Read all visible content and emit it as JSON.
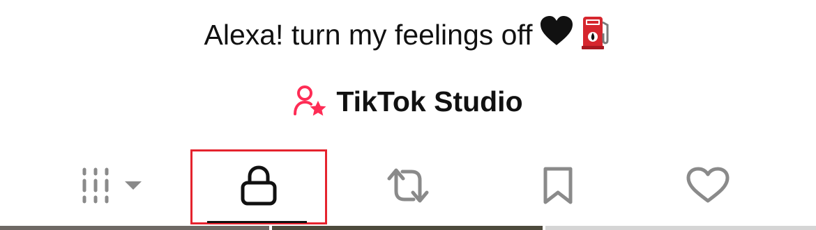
{
  "profile": {
    "bio": "Alexa! turn my feelings off",
    "bio_emojis": [
      "black-heart-icon",
      "fuel-pump-icon"
    ],
    "studio_label": "TikTok Studio"
  },
  "tabs": [
    {
      "name": "videos-grid",
      "icon": "grid-icon",
      "selected": false
    },
    {
      "name": "private",
      "icon": "lock-icon",
      "selected": true
    },
    {
      "name": "reposts",
      "icon": "repost-icon",
      "selected": false
    },
    {
      "name": "favorites",
      "icon": "bookmark-icon",
      "selected": false
    },
    {
      "name": "liked",
      "icon": "heart-icon",
      "selected": false
    }
  ],
  "colors": {
    "accent": "#fe2c55",
    "highlight_box": "#e5232e",
    "icon_gray": "#8a8a8a",
    "text": "#111111"
  }
}
